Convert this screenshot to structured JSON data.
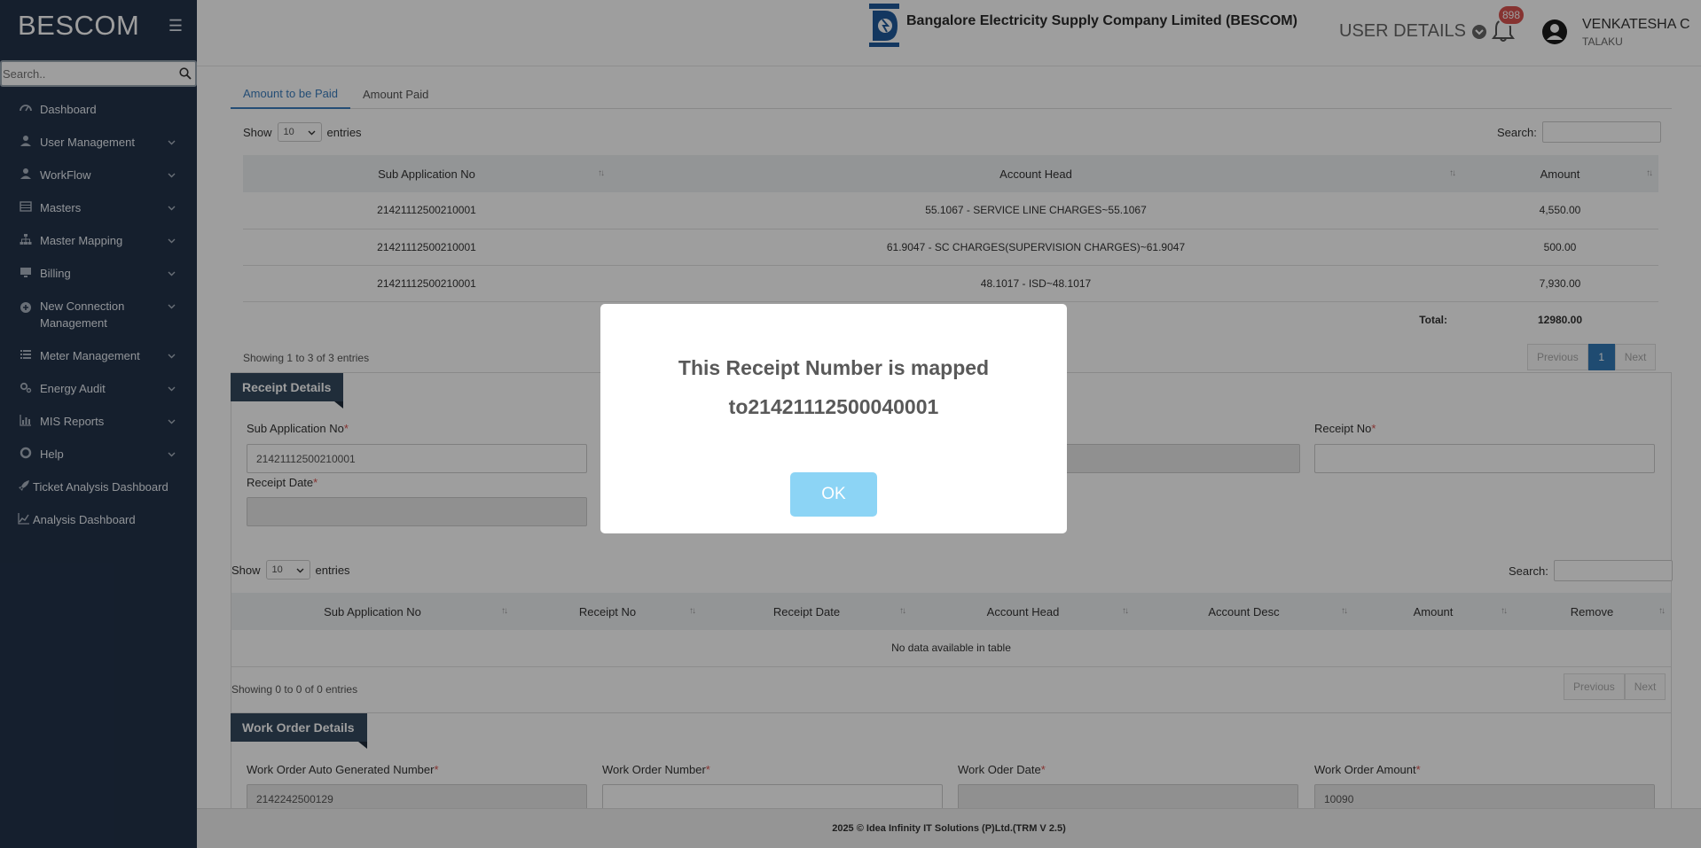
{
  "sidebar": {
    "brand": "BESCOM",
    "search_placeholder": "Search..",
    "items": [
      {
        "label": "Dashboard",
        "icon": "dashboard-icon"
      },
      {
        "label": "User Management",
        "icon": "user-icon"
      },
      {
        "label": "WorkFlow",
        "icon": "user-icon"
      },
      {
        "label": "Masters",
        "icon": "table-icon"
      },
      {
        "label": "Master Mapping",
        "icon": "sitemap-icon"
      },
      {
        "label": "Billing",
        "icon": "desktop-icon"
      },
      {
        "label": "New Connection Management",
        "icon": "plus-circle-icon"
      },
      {
        "label": "Meter Management",
        "icon": "list-icon"
      },
      {
        "label": "Energy Audit",
        "icon": "gears-icon"
      },
      {
        "label": "MIS Reports",
        "icon": "bar-chart-icon"
      },
      {
        "label": "Help",
        "icon": "help-icon"
      },
      {
        "label": "Ticket Analysis Dashboard",
        "icon": "rocket-icon"
      },
      {
        "label": "Analysis Dashboard",
        "icon": "line-chart-icon"
      }
    ]
  },
  "header": {
    "company": "Bangalore Electricity Supply Company Limited (BESCOM)",
    "user_details": "USER DETAILS",
    "notification_count": "898",
    "user_name": "VENKATESHA C",
    "user_role": "TALAKU"
  },
  "tabs": [
    "Amount to be Paid",
    "Amount Paid"
  ],
  "table1": {
    "show": "Show",
    "entries": "entries",
    "page_size": "10",
    "search_label": "Search:",
    "columns": [
      "Sub Application No",
      "Account Head",
      "Amount"
    ],
    "rows": [
      [
        "21421112500210001",
        "55.1067 - SERVICE LINE CHARGES~55.1067",
        "4,550.00"
      ],
      [
        "21421112500210001",
        "61.9047 - SC CHARGES(SUPERVISION CHARGES)~61.9047",
        "500.00"
      ],
      [
        "21421112500210001",
        "48.1017 - ISD~48.1017",
        "7,930.00"
      ]
    ],
    "total_label": "Total:",
    "total_value": "12980.00",
    "info": "Showing 1 to 3 of 3 entries",
    "prev": "Previous",
    "page": "1",
    "next": "Next"
  },
  "receipt": {
    "title": "Receipt Details",
    "sub_app_label": "Sub Application No",
    "sub_app_value": "21421112500210001",
    "receipt_no_label": "Receipt No",
    "receipt_date_label": "Receipt Date"
  },
  "table2": {
    "show": "Show",
    "entries": "entries",
    "page_size": "10",
    "search_label": "Search:",
    "columns": [
      "Sub Application No",
      "Receipt No",
      "Receipt Date",
      "Account Head",
      "Account Desc",
      "Amount",
      "Remove"
    ],
    "empty": "No data available in table",
    "info": "Showing 0 to 0 of 0 entries",
    "prev": "Previous",
    "next": "Next"
  },
  "work_order": {
    "title": "Work Order Details",
    "auto_label": "Work Order Auto Generated Number",
    "auto_value": "2142242500129",
    "number_label": "Work Order Number",
    "date_label": "Work Oder Date",
    "amount_label": "Work Order Amount",
    "amount_value": "10090"
  },
  "footer": "2025 © Idea Infinity IT Solutions (P)Ltd.(TRM V 2.5)",
  "modal": {
    "line1": "This Receipt Number is mapped",
    "line2": "to21421112500040001",
    "ok": "OK"
  },
  "required_mark": "*"
}
